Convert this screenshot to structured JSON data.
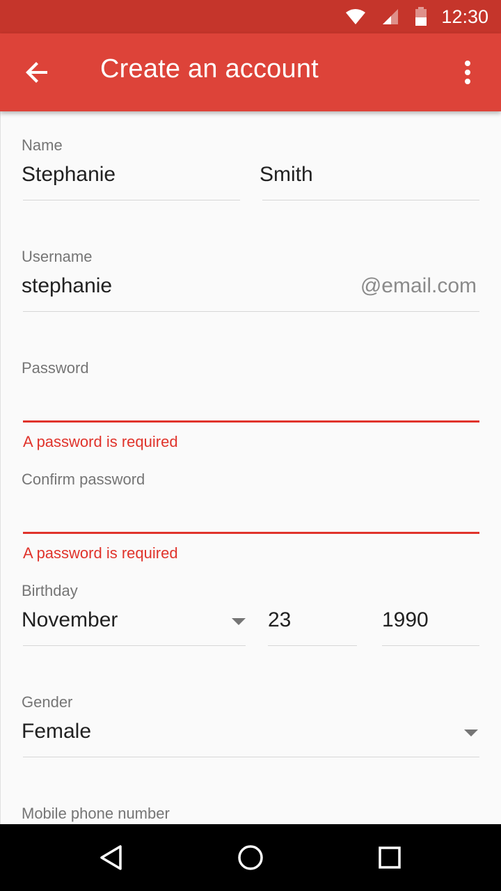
{
  "status_bar": {
    "time": "12:30",
    "icons": [
      "wifi-icon",
      "signal-icon",
      "battery-icon"
    ]
  },
  "app_bar": {
    "title": "Create an account",
    "back_icon": "arrow-back-icon",
    "menu_icon": "more-vert-icon"
  },
  "form": {
    "name": {
      "label": "Name",
      "first": "Stephanie",
      "last": "Smith"
    },
    "username": {
      "label": "Username",
      "value": "stephanie",
      "suffix": "@email.com"
    },
    "password": {
      "label": "Password",
      "value": "",
      "error": "A password is required"
    },
    "confirm_password": {
      "label": "Confirm password",
      "value": "",
      "error": "A password is required"
    },
    "birthday": {
      "label": "Birthday",
      "month": "November",
      "day": "23",
      "year": "1990"
    },
    "gender": {
      "label": "Gender",
      "value": "Female"
    },
    "mobile": {
      "label": "Mobile phone number"
    }
  },
  "colors": {
    "app_bar": "#dd4339",
    "status_bar": "#c5352b",
    "error": "#e0332b"
  },
  "nav_bar": {
    "icons": [
      "back-triangle-icon",
      "home-circle-icon",
      "recents-square-icon"
    ]
  }
}
